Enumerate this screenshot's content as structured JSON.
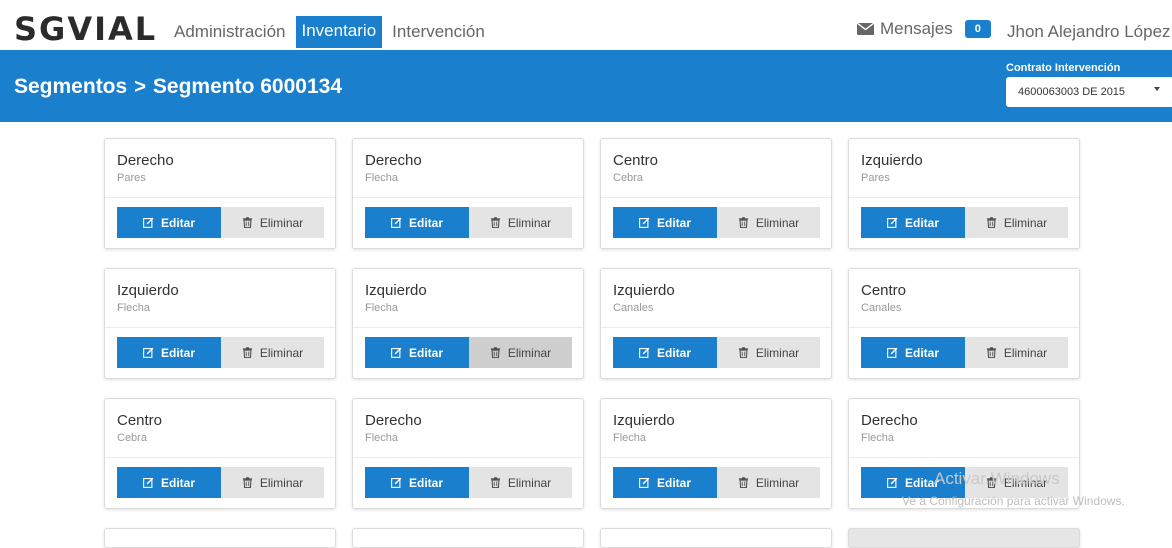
{
  "brand": "SGVIAL",
  "nav": {
    "items": [
      {
        "label": "Administración",
        "active": false
      },
      {
        "label": "Inventario",
        "active": true
      },
      {
        "label": "Intervención",
        "active": false
      }
    ]
  },
  "messages": {
    "label": "Mensajes",
    "count": "0"
  },
  "user": {
    "name": "Jhon Alejandro López"
  },
  "breadcrumb": {
    "parent": "Segmentos",
    "separator": ">",
    "current": "Segmento 6000134"
  },
  "contract": {
    "label": "Contrato Intervención",
    "selected": "4600063003 DE 2015"
  },
  "buttons": {
    "edit": "Editar",
    "delete": "Eliminar"
  },
  "cards": [
    {
      "title": "Derecho",
      "subtitle": "Pares"
    },
    {
      "title": "Derecho",
      "subtitle": "Flecha"
    },
    {
      "title": "Centro",
      "subtitle": "Cebra"
    },
    {
      "title": "Izquierdo",
      "subtitle": "Pares"
    },
    {
      "title": "Izquierdo",
      "subtitle": "Flecha"
    },
    {
      "title": "Izquierdo",
      "subtitle": "Flecha"
    },
    {
      "title": "Izquierdo",
      "subtitle": "Canales"
    },
    {
      "title": "Centro",
      "subtitle": "Canales"
    },
    {
      "title": "Centro",
      "subtitle": "Cebra"
    },
    {
      "title": "Derecho",
      "subtitle": "Flecha"
    },
    {
      "title": "Izquierdo",
      "subtitle": "Flecha"
    },
    {
      "title": "Derecho",
      "subtitle": "Flecha"
    }
  ],
  "watermark": {
    "title": "Activar Windows",
    "text": "Ve a Configuración para activar Windows."
  },
  "colors": {
    "primary": "#1a7fcc",
    "delete_bg": "#e4e4e4"
  }
}
